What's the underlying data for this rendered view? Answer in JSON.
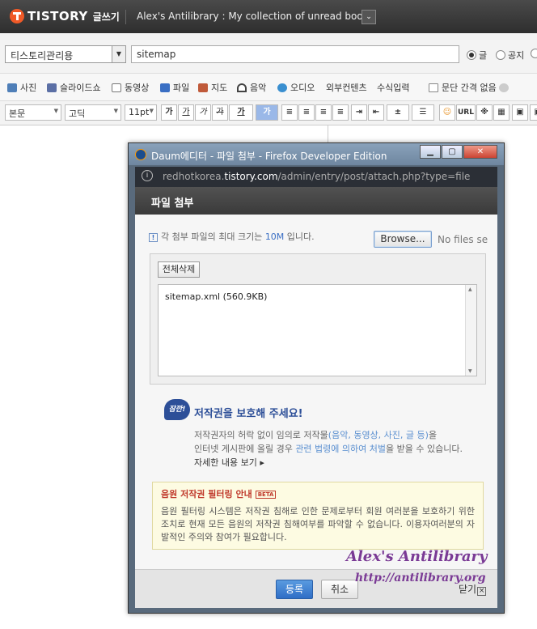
{
  "topbar": {
    "logo": "TISTORY",
    "sub": "글쓰기",
    "blog_title": "Alex's Antilibrary : My collection of unread books",
    "dropdown": "⌄"
  },
  "post": {
    "category": "티스토리관리용",
    "title_value": "sitemap",
    "radios": [
      "글",
      "공지"
    ]
  },
  "toolbar": {
    "items": [
      "사진",
      "슬라이드쇼",
      "동영상",
      "파일",
      "지도",
      "음악",
      "오디오",
      "외부컨텐츠",
      "수식입력"
    ],
    "no_spacing": "문단 간격 없음"
  },
  "format": {
    "block": "본문",
    "font": "고딕",
    "size": "11pt",
    "buttons": [
      "가",
      "가",
      "가",
      "가",
      "가"
    ],
    "url": "URL"
  },
  "dialog": {
    "title": "Daum에디터 - 파일 첨부 - Firefox Developer Edition",
    "url_host_pre": "redhotkorea.",
    "url_host": "tistory.com",
    "url_path": "/admin/entry/post/attach.php?type=file",
    "header": "파일 첨부",
    "notice_pre": "각 첨부 파일의 최대 크기는 ",
    "notice_size": "10M",
    "notice_post": " 입니다.",
    "browse": "Browse...",
    "no_files": "No files se",
    "delete_all": "전체삭제",
    "files": [
      "sitemap.xml (560.9KB)"
    ],
    "copyright": {
      "badge": "잠깐!",
      "title": "저작권을 보호해 주세요!",
      "line1_pre": "저작권자의 허락 없이 임의로 저작물",
      "line1_link": "(음악, 동영상, 사진, 글 등)",
      "line1_post": "을",
      "line2_pre": "인터넷 게시판에 올릴 경우 ",
      "line2_link": "관련 법령에 의하여 처벌",
      "line2_post": "을 받을 수 있습니다.",
      "more": "자세한 내용 보기 ▸"
    },
    "filter": {
      "title": "음원 저작권 필터링 안내",
      "beta": "BETA",
      "text": "음원 필터링 시스템은 저작권 침해로 인한 문제로부터 회원 여러분을 보호하기 위한 조치로 현재 모든 음원의 저작권 침해여부를 파악할 수 없습니다. 이용자여러분의 자발적인 주의와 참여가 필요합니다."
    },
    "ok": "등록",
    "cancel": "취소",
    "close": "닫기",
    "close_x": "×"
  },
  "watermark": {
    "line1": "Alex's Antilibrary",
    "line2": "http://antilibrary.org"
  }
}
